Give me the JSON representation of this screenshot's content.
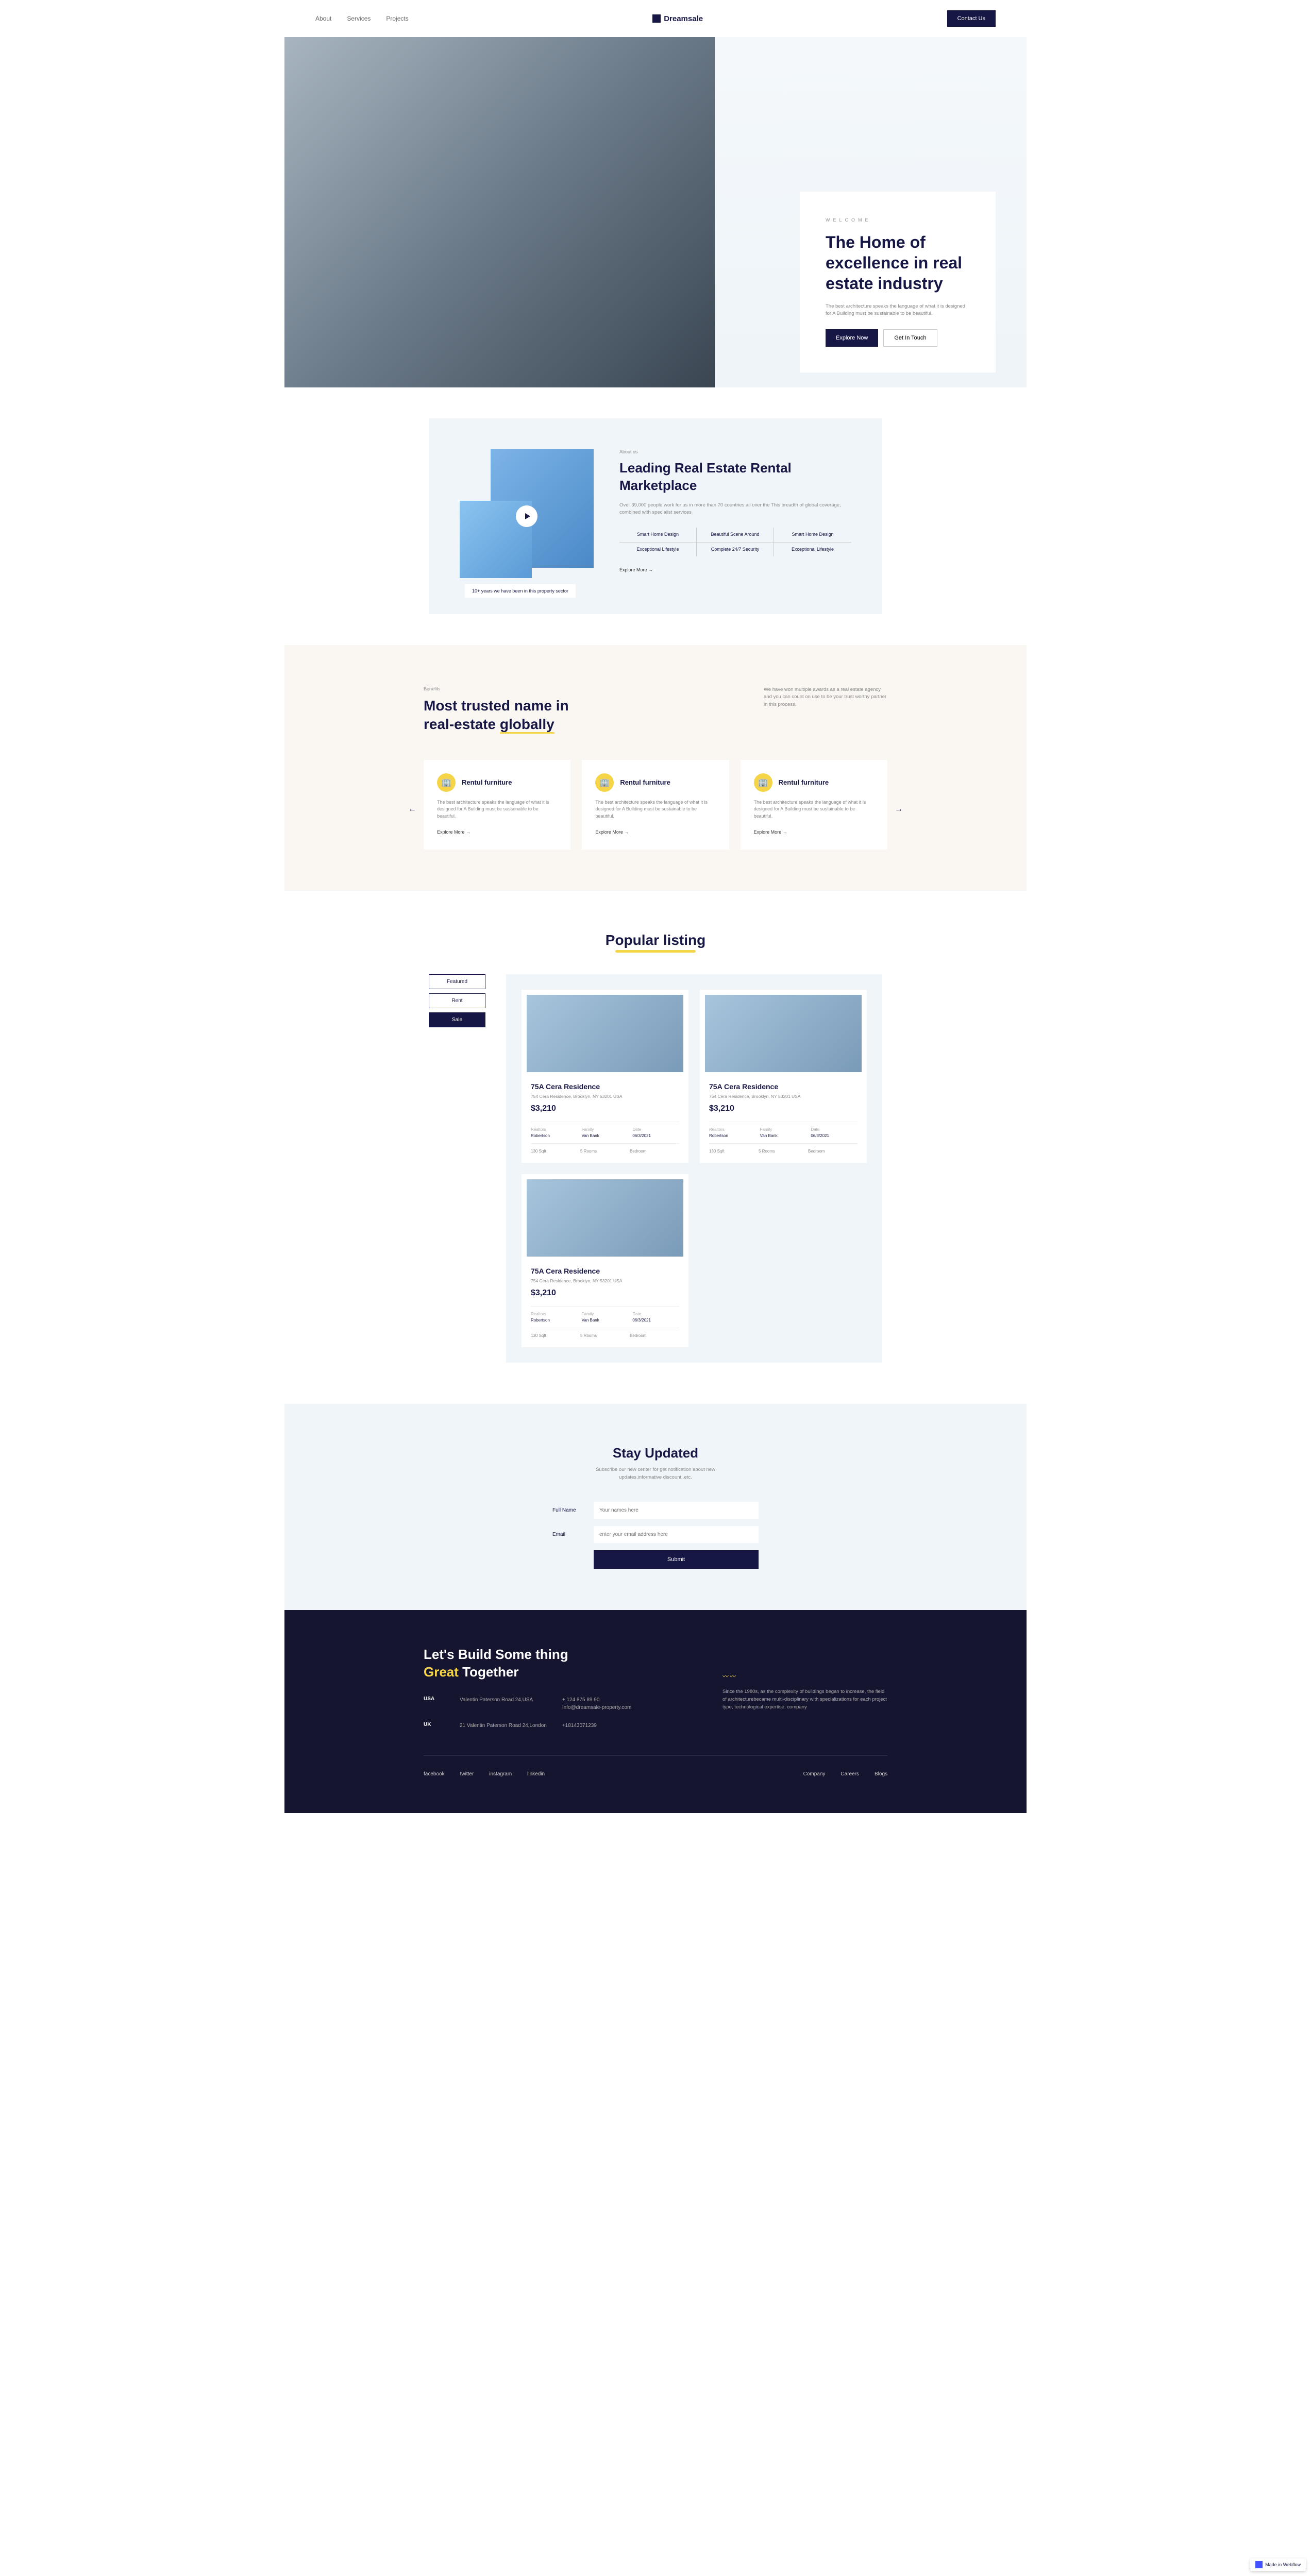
{
  "nav": {
    "links": [
      "About",
      "Services",
      "Projects"
    ],
    "brand": "Dreamsale",
    "cta": "Contact Us"
  },
  "hero": {
    "welcome": "WELCOME",
    "title": "The Home of excellence in real estate industry",
    "desc": "The best architecture speaks the language of what it is designed for A Building must be sustainable to be beautiful.",
    "btn1": "Explore Now",
    "btn2": "Get In Touch"
  },
  "about": {
    "caption": "10+ years we have been in this property sector",
    "eyebrow": "About us",
    "title": "Leading Real Estate Rental Marketplace",
    "desc": "Over 39,000 people work for us in more than 70 countries all over the This breadth of global coverage, combined with specialist services",
    "features": [
      "Smart Home Design",
      "Beautiful Scene Around",
      "Smart Home Design",
      "Exceptional Lifestyle",
      "Complete 24/7 Security",
      "Exceptional Lifestyle"
    ],
    "explore": "Explore More"
  },
  "benefits": {
    "eyebrow": "Benefits",
    "title_line1": "Most trusted name in",
    "title_line2": "real-estate ",
    "title_underline": "globally",
    "desc": "We have won multiple awards as a real estate agency and you can count on use to be your trust worthy partner in this process.",
    "cards": [
      {
        "title": "Rentul furniture",
        "desc": "The best architecture speaks the language of what it is designed for A Building must be sustainable to be beautiful.",
        "link": "Explore More"
      },
      {
        "title": "Rentul furniture",
        "desc": "The best architecture speaks the language of what it is designed for A Building must be sustainable to be beautiful.",
        "link": "Explore More"
      },
      {
        "title": "Rentul furniture",
        "desc": "The best architecture speaks the language of what it is designed for A Building must be sustainable to be beautiful.",
        "link": "Explore More"
      }
    ]
  },
  "listing": {
    "title": "Popular listing",
    "tabs": [
      "Featured",
      "Rent",
      "Sale"
    ],
    "cards": [
      {
        "name": "75A Cera Residence",
        "addr": "754 Cera Residence, Brooklyn, NY 53201 USA",
        "price": "$3,210",
        "realtors_lbl": "Realtors",
        "realtors_val": "Robertson",
        "family_lbl": "Family",
        "family_val": "Van Bank",
        "date_lbl": "Date",
        "date_val": "06/3/2021",
        "sqft": "130 Sqft",
        "rooms": "5 Rooms",
        "baths": "Bedroom"
      },
      {
        "name": "75A Cera Residence",
        "addr": "754 Cera Residence, Brooklyn, NY 53201 USA",
        "price": "$3,210",
        "realtors_lbl": "Realtors",
        "realtors_val": "Robertson",
        "family_lbl": "Family",
        "family_val": "Van Bank",
        "date_lbl": "Date",
        "date_val": "06/3/2021",
        "sqft": "130 Sqft",
        "rooms": "5 Rooms",
        "baths": "Bedroom"
      },
      {
        "name": "75A Cera Residence",
        "addr": "754 Cera Residence, Brooklyn, NY 53201 USA",
        "price": "$3,210",
        "realtors_lbl": "Realtors",
        "realtors_val": "Robertson",
        "family_lbl": "Family",
        "family_val": "Van Bank",
        "date_lbl": "Date",
        "date_val": "06/3/2021",
        "sqft": "130 Sqft",
        "rooms": "5 Rooms",
        "baths": "Bedroom"
      }
    ]
  },
  "updated": {
    "title": "Stay Updated",
    "desc": "Subscribe our new center for get notification about new updates,informative discount .etc.",
    "name_lbl": "Full Name",
    "name_ph": "Your names here",
    "email_lbl": "Email",
    "email_ph": "enter your email address here",
    "submit": "Submit"
  },
  "footer": {
    "title_pre": "Let's Build Some thing ",
    "title_yellow": "Great",
    "title_post": " Together",
    "contacts": [
      {
        "loc": "USA",
        "addr": "Valentin Paterson Road 24,USA",
        "phone": "+ 124 875 89 90",
        "email": "Info@dreamsale-property.com"
      },
      {
        "loc": "UK",
        "addr": "21 Valentin Paterson Road 24,London",
        "phone": "+18143071239",
        "email": ""
      }
    ],
    "right_text": "Since the 1980s, as the complexity of buildings began to increase, the field of architecturebecame multi-disciplinary with specializations for each project type, technological expertise. company",
    "social": [
      "facebook",
      "twitter",
      "instagram",
      "linkedin"
    ],
    "links": [
      "Company",
      "Careers",
      "Blogs"
    ]
  },
  "badge": "Made in Webflow"
}
